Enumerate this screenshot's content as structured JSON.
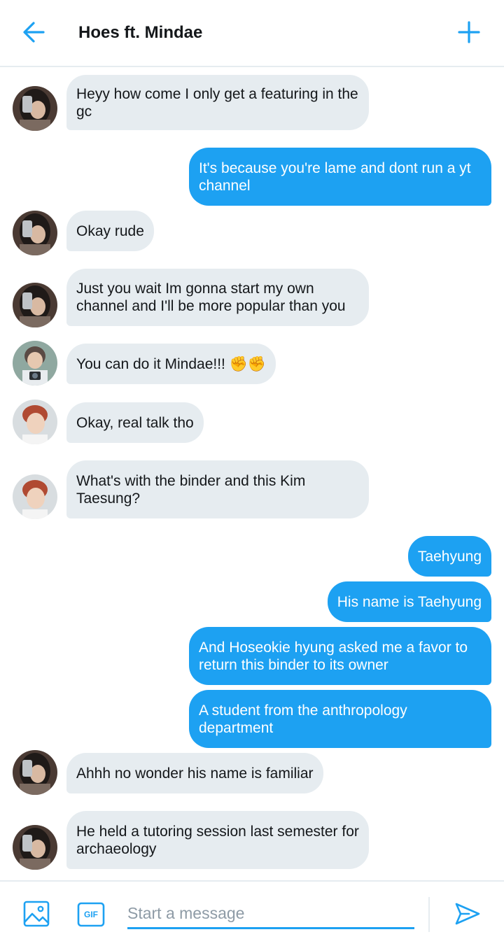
{
  "accent_color": "#1da1f2",
  "header": {
    "title": "Hoes ft. Mindae",
    "back_icon": "arrow-left-icon",
    "add_icon": "plus-icon"
  },
  "messages": [
    {
      "direction": "in",
      "sender_avatar": "avatar-mirror-selfie",
      "text": "Heyy how come I only get a featuring in the gc"
    },
    {
      "direction": "out",
      "text": "It's because you're lame and dont run a yt channel"
    },
    {
      "direction": "in",
      "sender_avatar": "avatar-mirror-selfie",
      "text": "Okay rude"
    },
    {
      "direction": "in",
      "sender_avatar": "avatar-mirror-selfie",
      "text": "Just you wait Im gonna start my own channel and I'll be more popular than you"
    },
    {
      "direction": "in",
      "sender_avatar": "avatar-camera-guy",
      "text": "You can do it Mindae!!! ✊✊"
    },
    {
      "direction": "in",
      "sender_avatar": "avatar-red-hair",
      "text": "Okay, real talk tho"
    },
    {
      "direction": "in",
      "sender_avatar": "avatar-red-hair",
      "text": "What's with the binder and this Kim Taesung?"
    },
    {
      "direction": "out",
      "text": "Taehyung"
    },
    {
      "direction": "out",
      "text": "His name is Taehyung"
    },
    {
      "direction": "out",
      "text": "And Hoseokie hyung asked me a favor to return this binder to its owner"
    },
    {
      "direction": "out",
      "text": "A student from the anthropology department"
    },
    {
      "direction": "in",
      "sender_avatar": "avatar-mirror-selfie",
      "text": "Ahhh no wonder his name is familiar"
    },
    {
      "direction": "in",
      "sender_avatar": "avatar-mirror-selfie",
      "text": "He held a tutoring session last semester for archaeology"
    }
  ],
  "composer": {
    "placeholder": "Start a message",
    "value": "",
    "image_icon": "image-icon",
    "gif_label": "GIF",
    "send_icon": "send-icon"
  }
}
